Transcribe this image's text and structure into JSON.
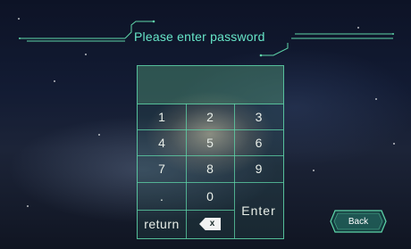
{
  "title": "Please enter password",
  "keypad": {
    "keys": [
      "1",
      "2",
      "3",
      "4",
      "5",
      "6",
      "7",
      "8",
      "9",
      ".",
      "0",
      "Enter",
      "return"
    ],
    "backspace_label": "x"
  },
  "back_button": {
    "label": "Back"
  },
  "colors": {
    "accent": "#5fd7aa",
    "title": "#67e6c8"
  }
}
